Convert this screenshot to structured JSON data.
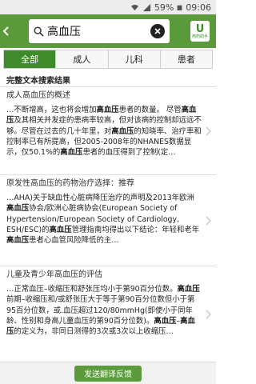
{
  "status": {
    "battery": "59%",
    "time": "09:06"
  },
  "search": {
    "query": "高血压"
  },
  "app_logo": {
    "letter": "U",
    "text": "用药助手"
  },
  "tabs": [
    {
      "label": "全部",
      "active": true
    },
    {
      "label": "成人",
      "active": false
    },
    {
      "label": "儿科",
      "active": false
    },
    {
      "label": "患者",
      "active": false
    }
  ],
  "results_header": "完整文本搜索结果",
  "results": [
    {
      "title": "成人高血压的概述",
      "body": "…不断增高，这也将会增加<b>高血压</b>患者的数量。 尽管<b>高血压</b>及其相关并发症的患病率较高，但对该病的控制却远远不够。尽管在过去的几十年里，对<b>高血压</b>的知晓率、治疗率和控制率已有所提高，但2005-2008年的NHANES数据显示，仅50.1%的<b>高血压</b>患者的血压得到了控制(定…"
    },
    {
      "title": "原发性高血压的药物治疗选择：推荐",
      "body": "…AHA)关于缺血性心脏病降压治疗的声明及2013年欧洲<b>高血压</b>协会/欧洲心脏病协会(European Society of Hypertension/European Society of Cardiology, ESH/ESC)的<b>高血压</b>管理指南均得出以下结论：年轻和老年<b>高血压</b>患者心血管风险降低的主…"
    },
    {
      "title": "儿童及青少年高血压的评估",
      "body": "…正常血压–收缩压和舒张压均小于第90百分位数。<b>高血压</b>前期–收缩压和/或舒张压大于等于第90百分位数但小于第95百分位数，或.血压超过120/80mmHg(即使小于同年龄、性别和身高儿童血压的第90百分位数)。<b>高血压</b>–<b>高血压</b>的定义为，非同日测得的3次或3次以上收缩压…"
    }
  ],
  "footer": {
    "button_label": "发送翻译反馈"
  },
  "colors": {
    "brand_green": "#5a9a3a",
    "tab_active": "#3f8a2b"
  }
}
